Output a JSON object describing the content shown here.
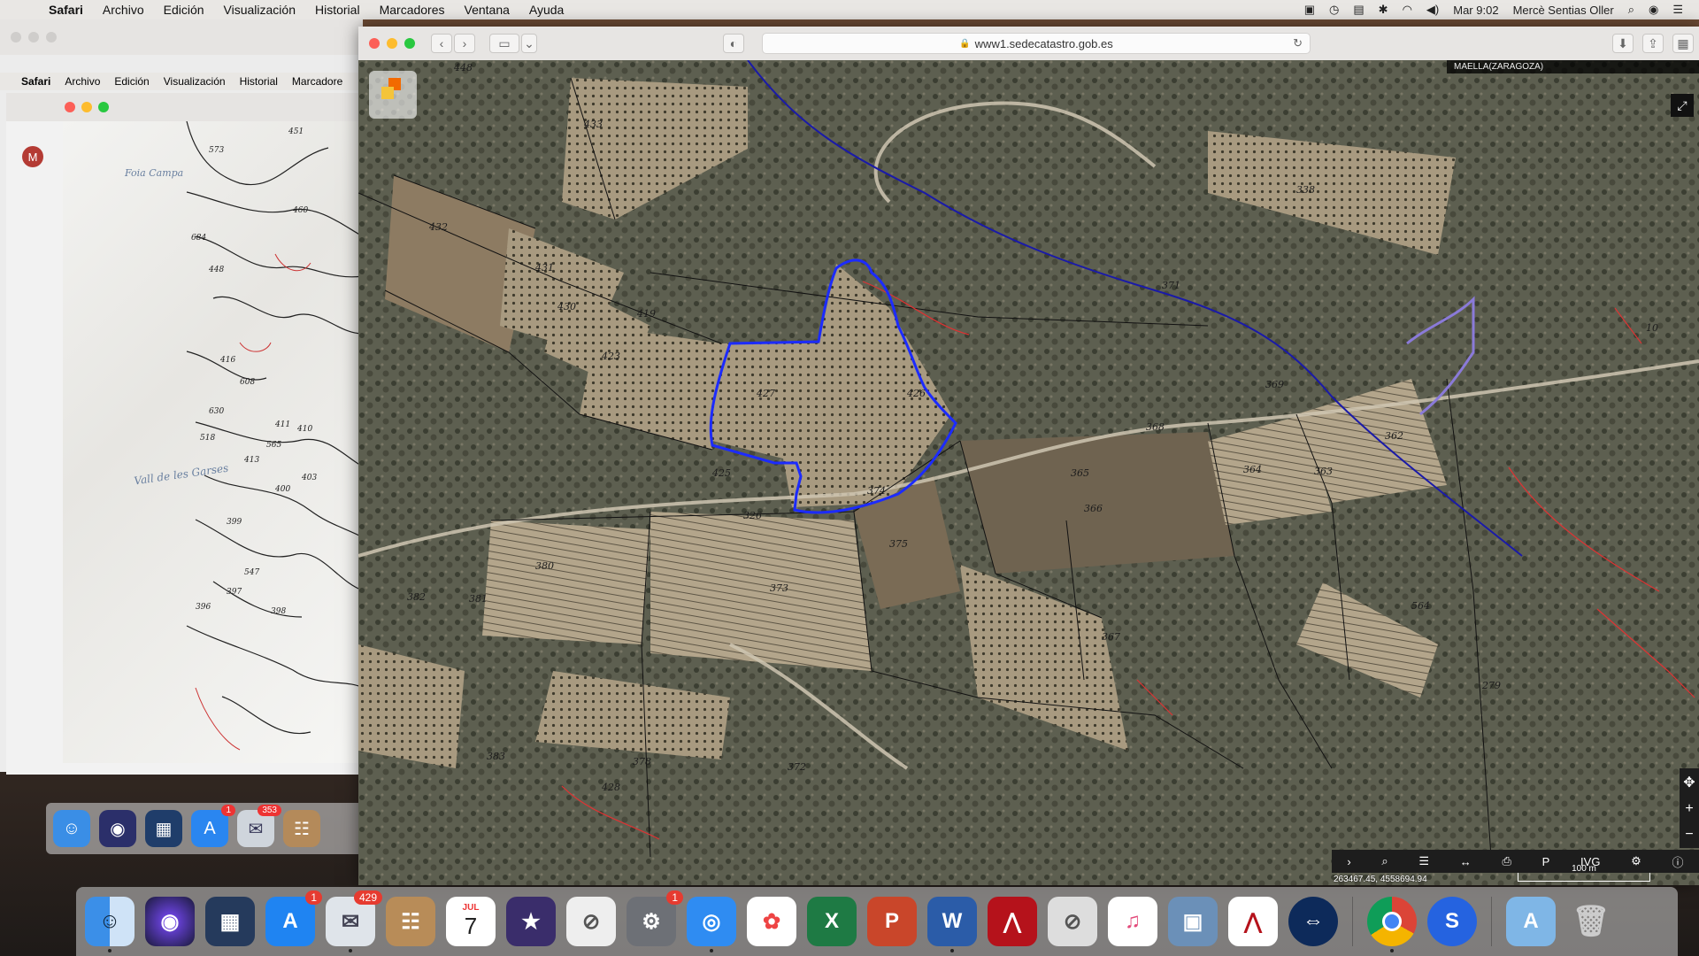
{
  "menubar": {
    "app": "Safari",
    "items": [
      "Archivo",
      "Edición",
      "Visualización",
      "Historial",
      "Marcadores",
      "Ventana",
      "Ayuda"
    ],
    "clock": "Mar 9:02",
    "user": "Mercè Sentias Oller"
  },
  "bg_window": {
    "menu": [
      "Safari",
      "Archivo",
      "Edición",
      "Visualización",
      "Historial",
      "Marcadore"
    ],
    "avatar_letter": "M",
    "topo_labels": {
      "place1": "Foia Campa",
      "place2": "Vall de les Garses",
      "parcels": [
        "451",
        "573",
        "460",
        "684",
        "448",
        "416",
        "608",
        "630",
        "411",
        "410",
        "518",
        "565",
        "413",
        "403",
        "400",
        "399",
        "547",
        "397",
        "396",
        "398"
      ]
    },
    "dock_badge": "353"
  },
  "main_window": {
    "url": "www1.sedecatastro.gob.es",
    "place": "MAELLA(ZARAGOZA)",
    "coordinates": "263467.45, 4558694.94",
    "scale": "100 m",
    "tools": [
      "›",
      "⌕",
      "☰",
      "↔",
      "⎙",
      "P",
      "IVG",
      "⚙",
      "ⓘ"
    ],
    "parcels": [
      "448",
      "433",
      "432",
      "431",
      "430",
      "423",
      "419",
      "427",
      "426",
      "425",
      "428",
      "326",
      "374",
      "375",
      "373",
      "380",
      "382",
      "381",
      "367",
      "366",
      "365",
      "364",
      "363",
      "362",
      "369",
      "368",
      "371",
      "338",
      "279",
      "383",
      "378",
      "372",
      "564",
      "10"
    ]
  },
  "dock": {
    "calendar_month": "JUL",
    "calendar_day": "7",
    "appstore_badge": "1",
    "mail_badge": "429",
    "settings_badge": "1"
  }
}
